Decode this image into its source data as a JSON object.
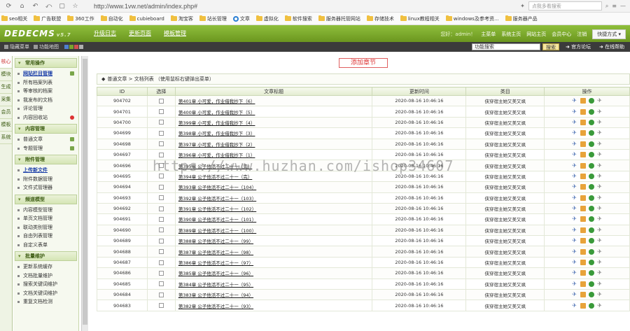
{
  "browser": {
    "url": "http://www.1vw.net/admin/index.php#",
    "search_placeholder": "点我多看搜索",
    "icons": [
      "refresh-icon",
      "home-icon",
      "back-icon",
      "forward-icon",
      "page-icon",
      "star-icon"
    ]
  },
  "bookmarks": [
    {
      "label": "seo相关",
      "icon": "folder"
    },
    {
      "label": "广告联盟",
      "icon": "folder"
    },
    {
      "label": "360工作",
      "icon": "folder"
    },
    {
      "label": "自动化",
      "icon": "folder"
    },
    {
      "label": "cubieboard",
      "icon": "folder"
    },
    {
      "label": "淘宝客",
      "icon": "folder"
    },
    {
      "label": "站长管理",
      "icon": "folder"
    },
    {
      "label": "文章",
      "icon": "ie"
    },
    {
      "label": "虚拟化",
      "icon": "folder"
    },
    {
      "label": "软件搜索",
      "icon": "folder"
    },
    {
      "label": "服务器托管网站",
      "icon": "folder"
    },
    {
      "label": "存储技术",
      "icon": "folder"
    },
    {
      "label": "linux教程相关",
      "icon": "folder"
    },
    {
      "label": "windows及参考资...",
      "icon": "folder"
    },
    {
      "label": "服务器产品",
      "icon": "folder"
    }
  ],
  "header": {
    "logo": "DEDECMS",
    "logo_version": "v5.7",
    "tabs": [
      "升级日志",
      "更新页面",
      "模板管理"
    ],
    "welcome": "您好：admin！",
    "links": [
      "主菜单",
      "系统主页",
      "网站主页",
      "会员中心",
      "注销"
    ],
    "quick_button": "快捷方式 ▾"
  },
  "subbar": {
    "hide_menu": "隐藏菜单",
    "feature_map": "功能地图",
    "skin_colors": [
      "#4f7fd0",
      "#79a32d",
      "#d04f4f",
      "#b0b0b0"
    ],
    "feature_search_value": "功能搜索",
    "search_button": "搜索",
    "forum_link": "官方论坛",
    "help_link": "在线帮助"
  },
  "vtabs": [
    "核心",
    "模块",
    "生成",
    "采集",
    "会员",
    "模板",
    "系统"
  ],
  "left_menu": [
    {
      "title": "常用操作",
      "items": [
        {
          "label": "网站栏目管理",
          "hl": true,
          "mark": "add"
        },
        {
          "label": "所有档案列表"
        },
        {
          "label": "等审核的档案"
        },
        {
          "label": "我发布的文档"
        },
        {
          "label": "评论管理"
        },
        {
          "label": "内容回收站",
          "mark": "red"
        }
      ]
    },
    {
      "title": "内容管理",
      "items": [
        {
          "label": "普通文章",
          "mark": "add"
        },
        {
          "label": "专题管理",
          "mark": "add"
        }
      ]
    },
    {
      "title": "附件管理",
      "items": [
        {
          "label": "上传新文件",
          "hl": true
        },
        {
          "label": "附件数据管理"
        },
        {
          "label": "文件式管理器"
        }
      ]
    },
    {
      "title": "频道模型",
      "items": [
        {
          "label": "内容模型管理"
        },
        {
          "label": "单页文档管理"
        },
        {
          "label": "联动类别管理"
        },
        {
          "label": "自由列表管理"
        },
        {
          "label": "自定义表单"
        }
      ]
    },
    {
      "title": "批量维护",
      "items": [
        {
          "label": "更新系统缓存"
        },
        {
          "label": "文档批量维护"
        },
        {
          "label": "搜索关键词维护"
        },
        {
          "label": "文档关键词维护"
        },
        {
          "label": "重复文档检测"
        }
      ]
    }
  ],
  "main": {
    "add_button": "添加章节",
    "breadcrumb": "普通文章 > 文档列表  （使用鼠标右键弹出菜单）",
    "columns": [
      "ID",
      "选择",
      "文章标题",
      "更新时间",
      "类目",
      "操作"
    ],
    "rows": [
      {
        "id": "904702",
        "title": "第401章 小可爱，作业借我抄下（6）",
        "time": "2020-08-16 10:46:16",
        "category": "侠穿宿主她又美又飒"
      },
      {
        "id": "904701",
        "title": "第400章 小可爱，作业借我抄下（5）",
        "time": "2020-08-16 10:46:16",
        "category": "侠穿宿主她又美又飒"
      },
      {
        "id": "904700",
        "title": "第399章 小可爱，作业借我抄下（4）",
        "time": "2020-08-16 10:46:16",
        "category": "侠穿宿主她又美又飒"
      },
      {
        "id": "904699",
        "title": "第398章 小可爱，作业借我抄下（3）",
        "time": "2020-08-16 10:46:16",
        "category": "侠穿宿主她又美又飒"
      },
      {
        "id": "904698",
        "title": "第397章 小可爱，作业借我抄下（2）",
        "time": "2020-08-16 10:46:16",
        "category": "侠穿宿主她又美又飒"
      },
      {
        "id": "904697",
        "title": "第396章 小可爱，作业借我抄下（1）",
        "time": "2020-08-16 10:46:16",
        "category": "侠穿宿主她又美又飒"
      },
      {
        "id": "904696",
        "title": "第395章 公子他活不过二十一（完）",
        "time": "2020-08-16 10:46:16",
        "category": "侠穿宿主她又美又飒"
      },
      {
        "id": "904695",
        "title": "第394章 公子他活不过二十一（完）",
        "time": "2020-08-16 10:46:16",
        "category": "侠穿宿主她又美又飒"
      },
      {
        "id": "904694",
        "title": "第393章 公子他活不过二十一（104）",
        "time": "2020-08-16 10:46:16",
        "category": "侠穿宿主她又美又飒"
      },
      {
        "id": "904693",
        "title": "第392章 公子他活不过二十一（103）",
        "time": "2020-08-16 10:46:16",
        "category": "侠穿宿主她又美又飒"
      },
      {
        "id": "904692",
        "title": "第391章 公子他活不过二十一（102）",
        "time": "2020-08-16 10:46:16",
        "category": "侠穿宿主她又美又飒"
      },
      {
        "id": "904691",
        "title": "第390章 公子他活不过二十一（101）",
        "time": "2020-08-16 10:46:16",
        "category": "侠穿宿主她又美又飒"
      },
      {
        "id": "904690",
        "title": "第389章 公子他活不过二十一（100）",
        "time": "2020-08-16 10:46:16",
        "category": "侠穿宿主她又美又飒"
      },
      {
        "id": "904689",
        "title": "第388章 公子他活不过二十一（99）",
        "time": "2020-08-16 10:46:16",
        "category": "侠穿宿主她又美又飒"
      },
      {
        "id": "904688",
        "title": "第387章 公子他活不过二十一（98）",
        "time": "2020-08-16 10:46:16",
        "category": "侠穿宿主她又美又飒"
      },
      {
        "id": "904687",
        "title": "第386章 公子他活不过二十一（97）",
        "time": "2020-08-16 10:46:16",
        "category": "侠穿宿主她又美又飒"
      },
      {
        "id": "904686",
        "title": "第385章 公子他活不过二十一（96）",
        "time": "2020-08-16 10:46:16",
        "category": "侠穿宿主她又美又飒"
      },
      {
        "id": "904685",
        "title": "第384章 公子他活不过二十一（95）",
        "time": "2020-08-16 10:46:16",
        "category": "侠穿宿主她又美又飒"
      },
      {
        "id": "904684",
        "title": "第383章 公子他活不过二十一（94）",
        "time": "2020-08-16 10:46:16",
        "category": "侠穿宿主她又美又飒"
      },
      {
        "id": "904683",
        "title": "第382章 公子他活不过二十一（93）",
        "time": "2020-08-16 10:46:16",
        "category": "侠穿宿主她又美又飒"
      }
    ]
  },
  "watermark": "https://www.huzhan.com/ishop34607"
}
